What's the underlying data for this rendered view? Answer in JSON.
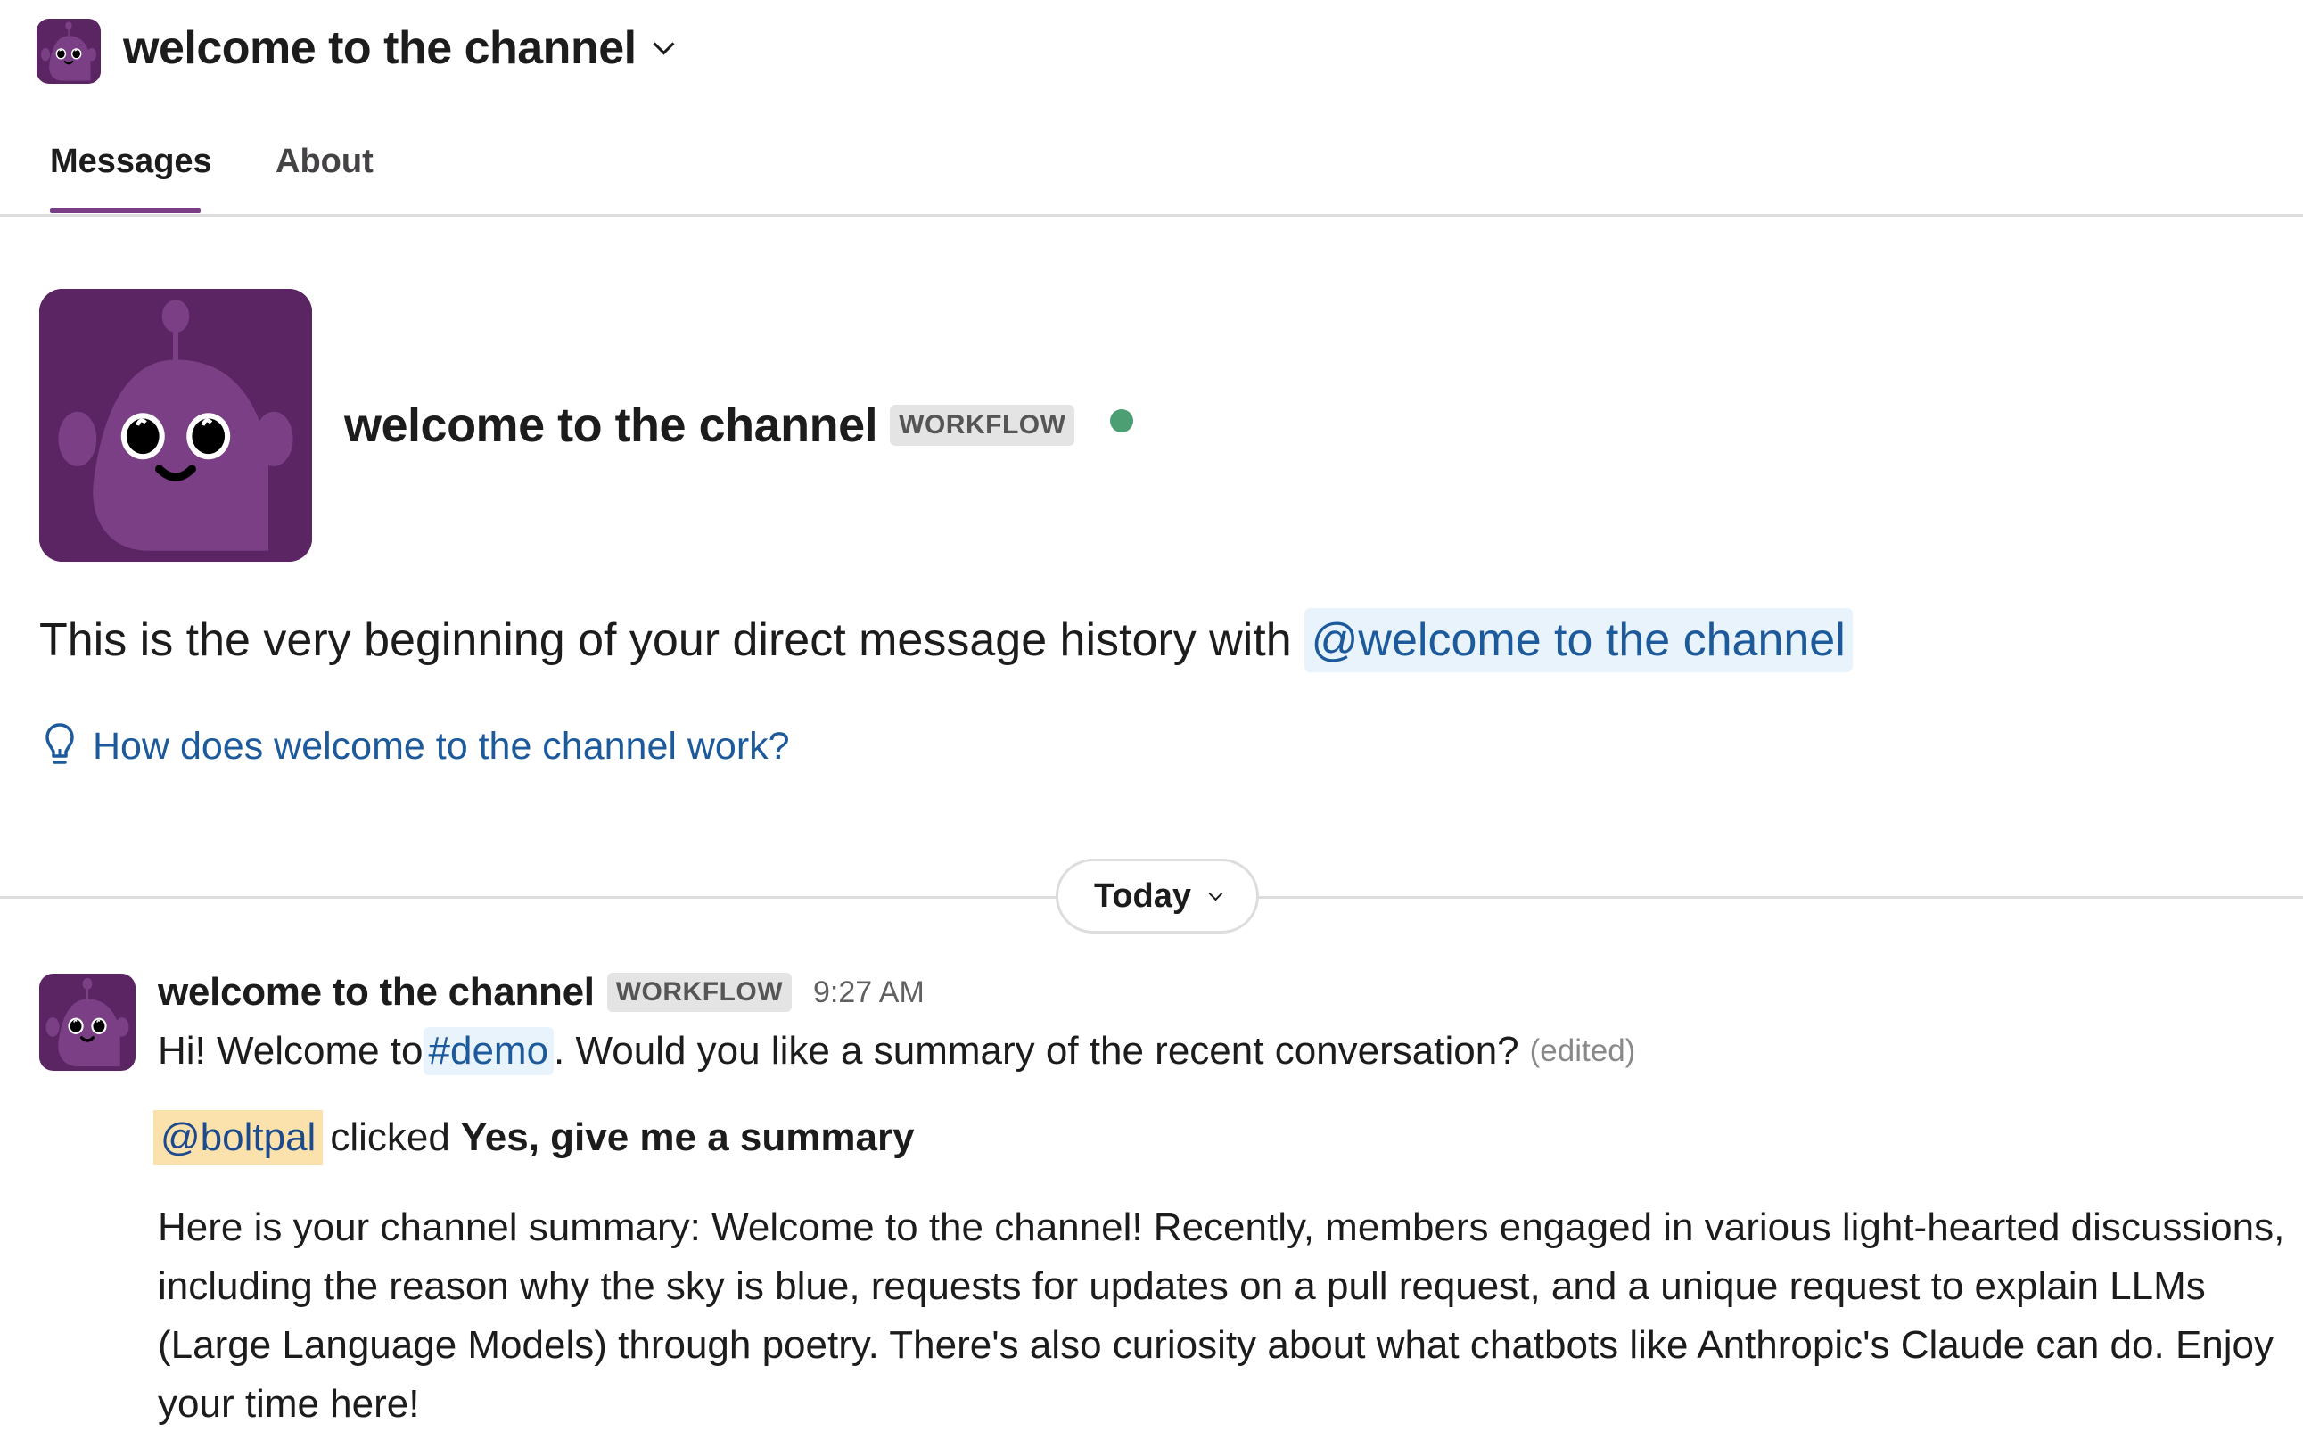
{
  "header": {
    "title": "welcome to the channel",
    "avatar_icon": "robot-avatar-icon",
    "dropdown_icon": "chevron-down-icon"
  },
  "tabs": [
    {
      "label": "Messages",
      "active": true
    },
    {
      "label": "About",
      "active": false
    }
  ],
  "intro": {
    "name": "welcome to the channel",
    "badge": "WORKFLOW",
    "presence": "online",
    "text": "This is the very beginning of your direct message history with",
    "mention": "@welcome to the channel",
    "help_link": "How does welcome to the channel work?",
    "help_icon": "lightbulb-icon"
  },
  "day_divider": {
    "label": "Today"
  },
  "message": {
    "sender": "welcome to the channel",
    "badge": "WORKFLOW",
    "time": "9:27 AM",
    "text_before": "Hi! Welcome to",
    "channel_link": "#demo",
    "text_after": ". Would you like a summary of the recent conversation?",
    "edited": "(edited)",
    "click_user": "@boltpal",
    "click_verb": "clicked",
    "click_button": "Yes, give me a summary",
    "summary": "Here is your channel summary: Welcome to the channel! Recently, members engaged in various light-hearted discussions, including the reason why the sky is blue, requests for updates on a pull request, and a unique request to explain LLMs (Large Language Models) through poetry. There's also curiosity about what chatbots like Anthropic's Claude can do. Enjoy your time here!"
  },
  "colors": {
    "brand_purple": "#5a2562",
    "tab_accent": "#7c3d87",
    "link_blue": "#1d5a9c",
    "presence_green": "#4b9f72",
    "mention_yellow": "#fbe2ad"
  }
}
